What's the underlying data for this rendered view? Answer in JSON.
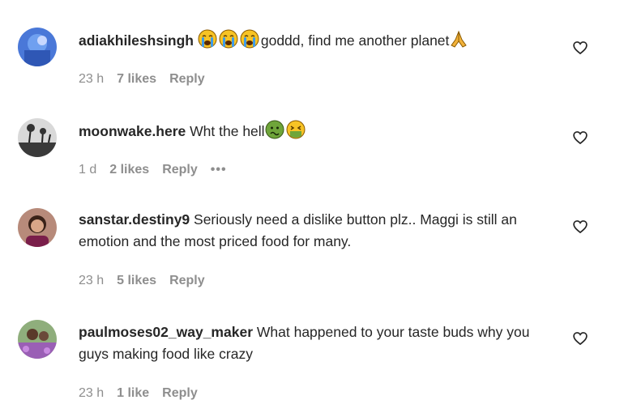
{
  "comments": [
    {
      "username": "adiakhileshsingh",
      "text_emojis": [
        "loudly-crying-face-emoji",
        "loudly-crying-face-emoji",
        "loudly-crying-face-emoji"
      ],
      "text": "goddd, find me another planet",
      "trail_emoji": "folded-hands-emoji",
      "time": "23 h",
      "likes": "7 likes",
      "reply": "Reply"
    },
    {
      "username": "moonwake.here",
      "text": "Wht the hell",
      "trail_emojis": [
        "nauseated-face-emoji",
        "vomiting-face-emoji"
      ],
      "time": "1 d",
      "likes": "2 likes",
      "reply": "Reply",
      "more": "•••"
    },
    {
      "username": "sanstar.destiny9",
      "text": "Seriously need a dislike button plz.. Maggi is still an emotion and the most priced food for many.",
      "time": "23 h",
      "likes": "5 likes",
      "reply": "Reply"
    },
    {
      "username": "paulmoses02_way_maker",
      "text": "What happened to your taste buds why you guys making food like crazy",
      "time": "23 h",
      "likes": "1 like",
      "reply": "Reply"
    }
  ],
  "icons": {
    "like": "heart-outline-icon"
  },
  "colors": {
    "text": "#262626",
    "secondary": "#8e8e8e",
    "emoji_yellow": "#f7c325",
    "emoji_tear": "#3d9be9",
    "emoji_green": "#6fa53a"
  }
}
